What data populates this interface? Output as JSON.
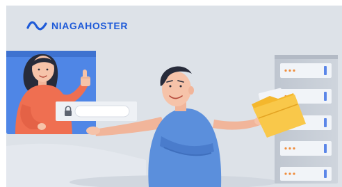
{
  "brand": {
    "name": "NIAGAHOSTER",
    "icon": "niagahoster-logo-icon",
    "color": "#1f5bd8"
  },
  "colors": {
    "background": "#dde2e8",
    "server_rack": "#c6ccd6",
    "shirt": "#5b8fdc",
    "woman_top": "#ef6f51",
    "folder": "#f4b72d",
    "led_orange": "#f08d3c",
    "led_blue": "#5b86e8"
  },
  "icons": [
    "lock-icon",
    "thumbs-up-icon",
    "folder-icon",
    "server-rack-icon"
  ]
}
